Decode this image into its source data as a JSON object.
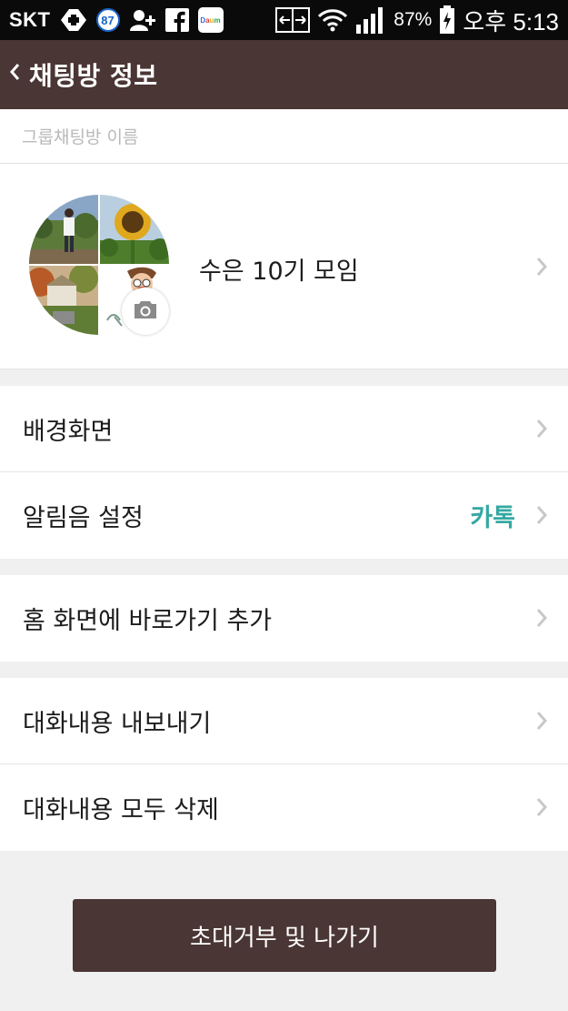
{
  "status_bar": {
    "carrier": "SKT",
    "badge_count": "87",
    "daum_label": "Daum",
    "battery_percent": "87%",
    "time": "오후 5:13"
  },
  "header": {
    "title": "채팅방 정보"
  },
  "section_label": "그룹채팅방 이름",
  "group": {
    "name": "수은 10기 모임"
  },
  "menu": {
    "background": "배경화면",
    "notification": "알림음 설정",
    "notification_value": "카톡",
    "home_shortcut": "홈 화면에 바로가기 추가",
    "export_chat": "대화내용 내보내기",
    "delete_chat": "대화내용 모두 삭제"
  },
  "exit_button": "초대거부 및 나가기",
  "colors": {
    "header": "#4a3634",
    "accent_teal": "#34a8a2",
    "page_bg": "#f0f0f0"
  }
}
